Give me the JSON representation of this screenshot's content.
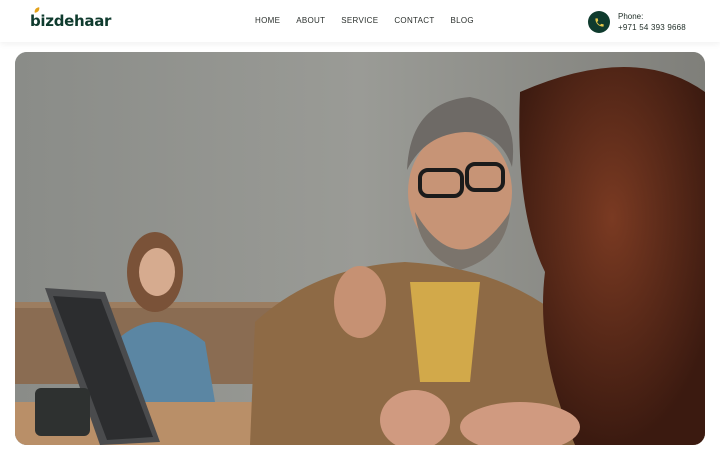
{
  "brand": {
    "name": "bizdehaar",
    "accent": "#0f3b2e",
    "leaf": "#e3a21a"
  },
  "nav": {
    "items": [
      {
        "label": "HOME"
      },
      {
        "label": "ABOUT"
      },
      {
        "label": "SERVICE"
      },
      {
        "label": "CONTACT"
      },
      {
        "label": "BLOG"
      }
    ]
  },
  "contact": {
    "label": "Phone:",
    "number": "+971 54 393 9668",
    "icon": "phone-icon"
  },
  "hero": {
    "image": "hero-photo"
  }
}
